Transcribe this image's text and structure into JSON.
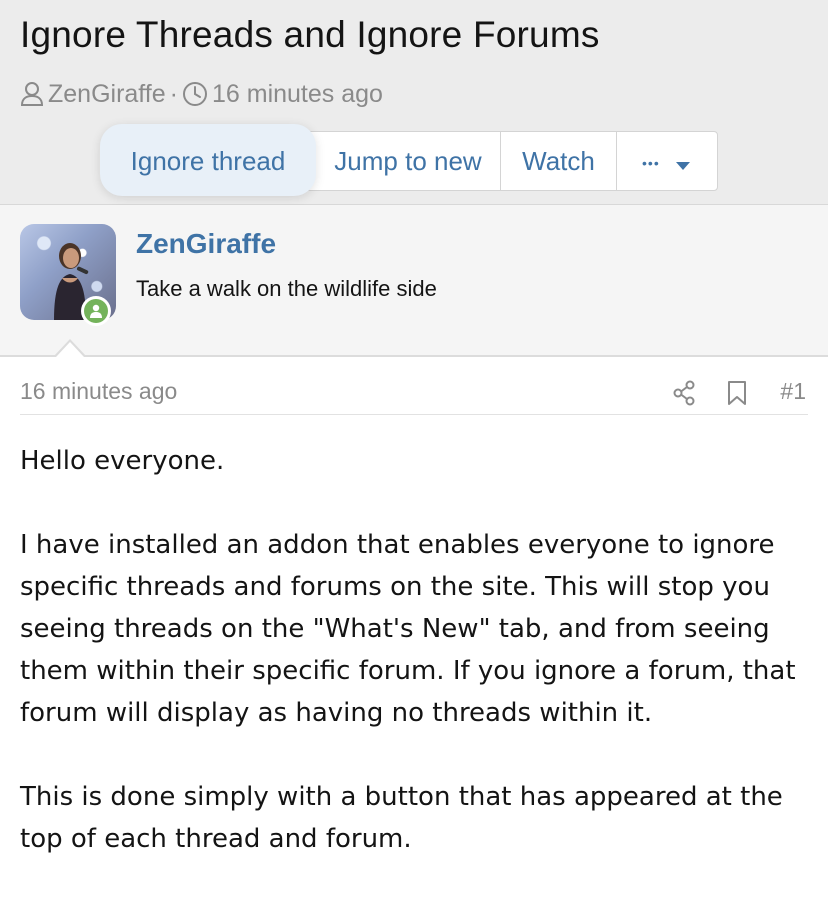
{
  "thread": {
    "title": "Ignore Threads and Ignore Forums",
    "author": "ZenGiraffe",
    "separator": "·",
    "time": "16 minutes ago"
  },
  "actions": {
    "ignore_thread": "Ignore thread",
    "jump_to_new": "Jump to new",
    "watch": "Watch",
    "more": "•••"
  },
  "author_block": {
    "name": "ZenGiraffe",
    "tagline": "Take a walk on the wildlife side"
  },
  "post": {
    "time": "16 minutes ago",
    "number": "#1",
    "paragraphs": [
      "Hello everyone.",
      "I have installed an addon that enables everyone to ignore specific threads and forums on the site. This will stop you seeing threads on the \"What's New\" tab, and from seeing them within their specific forum. If you ignore a forum, that forum will display as having no threads within it.",
      "This is done simply with a button that has appeared at the top of each thread and forum."
    ]
  },
  "colors": {
    "link": "#3f73a6",
    "muted": "#8a8a8a",
    "header_bg": "#ececec",
    "online": "#74b35b"
  },
  "icons": [
    "user-icon",
    "clock-icon",
    "caret-down-icon",
    "share-icon",
    "bookmark-icon"
  ]
}
